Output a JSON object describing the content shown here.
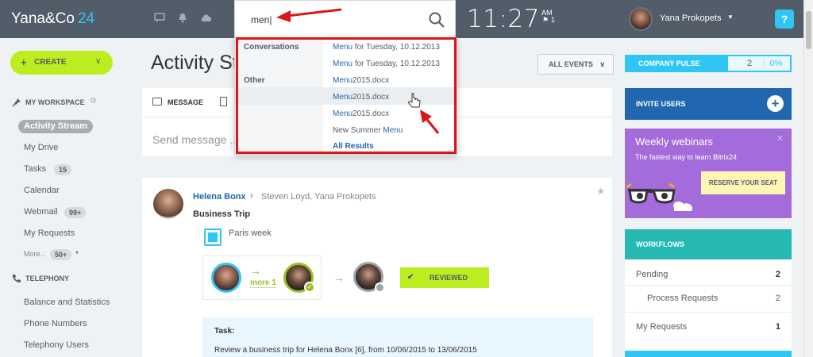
{
  "header": {
    "logo_name": "Yana&Co",
    "logo_number": "24",
    "search_value": "men|",
    "clock": "11:27",
    "clock_ampm": "AM",
    "flag_count": "1",
    "user_name": "Yana Prokopets",
    "help_label": "?"
  },
  "sidebar": {
    "create_label": "CREATE",
    "workspace_title": "MY WORKSPACE",
    "items": [
      {
        "label": "Activity Stream"
      },
      {
        "label": "My Drive"
      },
      {
        "label": "Tasks",
        "count": "15"
      },
      {
        "label": "Calendar"
      },
      {
        "label": "Webmail",
        "count": "99+"
      },
      {
        "label": "My Requests"
      },
      {
        "label": "More...",
        "count": "50+"
      }
    ],
    "telephony_title": "TELEPHONY",
    "telephony_items": [
      {
        "label": "Balance and Statistics"
      },
      {
        "label": "Phone Numbers"
      },
      {
        "label": "Telephony Users"
      }
    ]
  },
  "main": {
    "title": "Activity St",
    "all_events_label": "ALL EVENTS",
    "composer_tab": "MESSAGE",
    "composer_placeholder": "Send message ...",
    "post": {
      "author": "Helena Bonx",
      "recipients": "Steven Loyd, Yana Prokopets",
      "title": "Business Trip",
      "subtitle": "Paris week",
      "more_label": "more 1",
      "status_label": "REVIEWED",
      "task_label": "Task:",
      "task_text": "Review a business trip for Helena Bonx [6], from 10/06/2015 to 13/06/2015"
    }
  },
  "search_dropdown": {
    "categories": [
      "Conversations",
      "Other"
    ],
    "items": [
      {
        "prefix": "Menu",
        "suffix": " for Tuesday, 10.12.2013"
      },
      {
        "prefix": "Menu",
        "suffix": " for Tuesday, 10.12.2013"
      },
      {
        "prefix": "Menu",
        "suffix": "2015.docx"
      },
      {
        "prefix": "Menu",
        "suffix": "2015.docx"
      },
      {
        "prefix": "Menu",
        "suffix": "2015.docx"
      },
      {
        "prefix": "New Summer ",
        "suffix": "Menu"
      }
    ],
    "all_results": "All Results"
  },
  "right": {
    "pulse_label": "COMPANY PULSE",
    "pulse_count": "2",
    "pulse_percent": "0%",
    "invite_label": "INVITE USERS",
    "webinar_title": "Weekly webinars",
    "webinar_sub": "The fastest way to learn Bitrix24",
    "webinar_button": "RESERVE YOUR SEAT",
    "workflows_title": "WORKFLOWS",
    "workflows": [
      {
        "label": "Pending",
        "value": "2"
      },
      {
        "label": "Process Requests",
        "value": "2"
      },
      {
        "label": "My Requests",
        "value": "1"
      }
    ]
  },
  "colors": {
    "header": "#535c69",
    "accent_green": "#bbed21",
    "accent_blue": "#2fc6f6",
    "link_blue": "#2067b0",
    "annotation_red": "#dc1515"
  }
}
